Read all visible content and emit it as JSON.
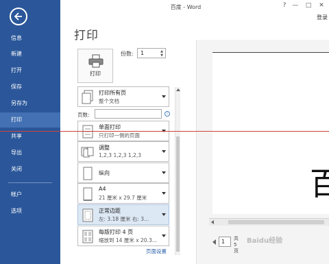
{
  "window": {
    "title": "百度 - Word",
    "help": "?",
    "minimize": "—",
    "maximize": "□",
    "close": "✕",
    "login": "登录"
  },
  "sidebar": {
    "items": [
      {
        "label": "信息"
      },
      {
        "label": "新建"
      },
      {
        "label": "打开"
      },
      {
        "label": "保存"
      },
      {
        "label": "另存为"
      },
      {
        "label": "打印"
      },
      {
        "label": "共享"
      },
      {
        "label": "导出"
      },
      {
        "label": "关闭"
      },
      {
        "label": "帐户"
      },
      {
        "label": "选项"
      }
    ],
    "active_index": 5,
    "bg_color": "#2b579a"
  },
  "print": {
    "title": "打印",
    "button_label": "打印",
    "copies_label": "份数:",
    "copies_value": "1",
    "pages_label": "页数:",
    "pages_value": "",
    "page_setup_link": "页面设置"
  },
  "settings": [
    {
      "main": "打印所有页",
      "sub": "整个文档",
      "icon": "pages-icon"
    },
    {
      "main": "单面打印",
      "sub": "只打印一侧的页面",
      "icon": "one-sided-icon"
    },
    {
      "main": "调整",
      "sub": "1,2,3    1,2,3    1,2,3",
      "icon": "collate-icon"
    },
    {
      "main": "纵向",
      "sub": "",
      "icon": "portrait-icon"
    },
    {
      "main": "A4",
      "sub": "21 厘米 x 29.7 厘米",
      "icon": "paper-size-icon"
    },
    {
      "main": "正常边距",
      "sub": "左: 3.18 厘米    右: 3...",
      "icon": "margins-icon"
    },
    {
      "main": "每版打印 4 页",
      "sub": "缩放到 14 厘米 x 20.3...",
      "icon": "pages-per-sheet-icon"
    }
  ],
  "preview": {
    "glyph": "百",
    "page_number": "1",
    "total_text": "共5页"
  },
  "watermark": "Baidu经验"
}
